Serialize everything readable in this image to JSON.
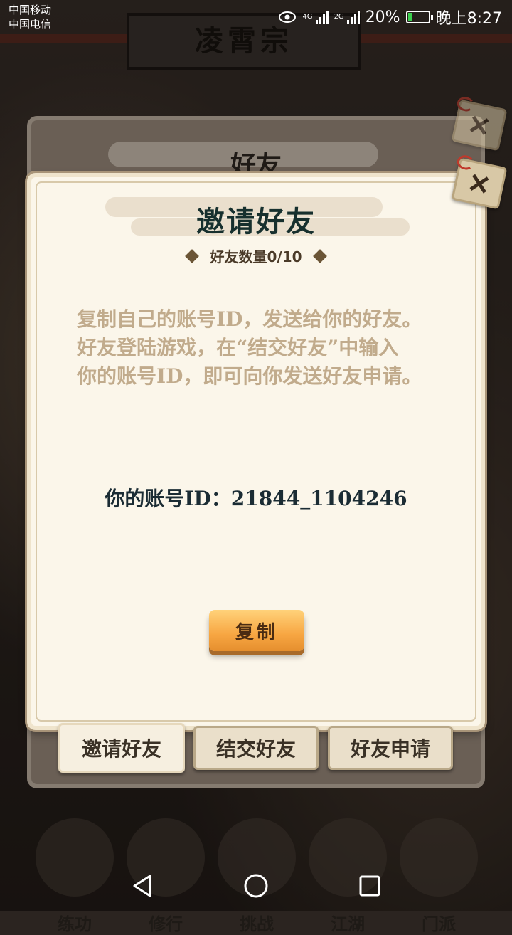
{
  "status_bar": {
    "carrier1": "中国移动",
    "carrier2": "中国电信",
    "net1": "4G",
    "net2": "2G",
    "battery_pct": "20%",
    "time": "晚上8:27",
    "battery_level": 0.2
  },
  "background": {
    "sect_title": "凌霄宗",
    "menu_items": [
      "练功",
      "修行",
      "挑战",
      "江湖",
      "门派"
    ]
  },
  "back_panel": {
    "title": "好友"
  },
  "dialog": {
    "title": "邀请好友",
    "friend_count_label": "好友数量0/10",
    "description_lines": [
      "复制自己的账号ID，发送给你的好友。",
      "好友登陆游戏，在“结交好友”中输入",
      "你的账号ID，即可向你发送好友申请。"
    ],
    "account_label": "你的账号ID：",
    "account_id": "21844_1104246",
    "copy_button": "复制"
  },
  "tabs": [
    {
      "label": "邀请好友",
      "active": true
    },
    {
      "label": "结交好友",
      "active": false
    },
    {
      "label": "好友申请",
      "active": false
    }
  ],
  "colors": {
    "dialog_bg": "#fbf6ea",
    "title_text": "#17302e",
    "description_text": "#c1ab8c",
    "button_orange": "#f7a642"
  }
}
